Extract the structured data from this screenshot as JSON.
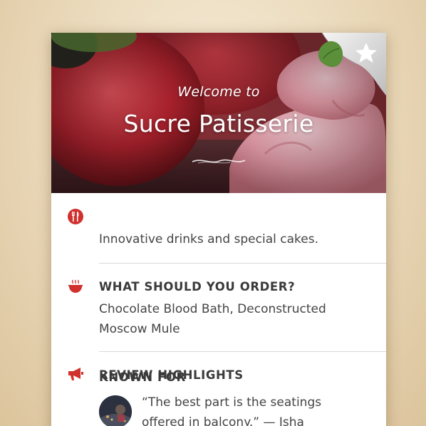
{
  "hero": {
    "welcome": "Welcome to",
    "title": "Sucre Patisserie"
  },
  "sections": {
    "known_for": {
      "icon": "fork-knife-icon",
      "heading": "KNOWN FOR",
      "body": "Innovative drinks and special cakes."
    },
    "order": {
      "icon": "bowl-icon",
      "heading": "WHAT SHOULD YOU ORDER?",
      "body_line1": "Chocolate Blood Bath, Deconstructed",
      "body_line2": "Moscow Mule"
    },
    "reviews": {
      "icon": "megaphone-icon",
      "heading": "REVIEW HIGHLIGHTS",
      "quote_line1": "“The best part is the seatings",
      "quote_line2": "offered in balcony.” — Isha"
    }
  },
  "colors": {
    "accent": "#d0312d",
    "heading": "#3a3a3a",
    "body": "#444444",
    "divider": "#d9d9d9"
  }
}
